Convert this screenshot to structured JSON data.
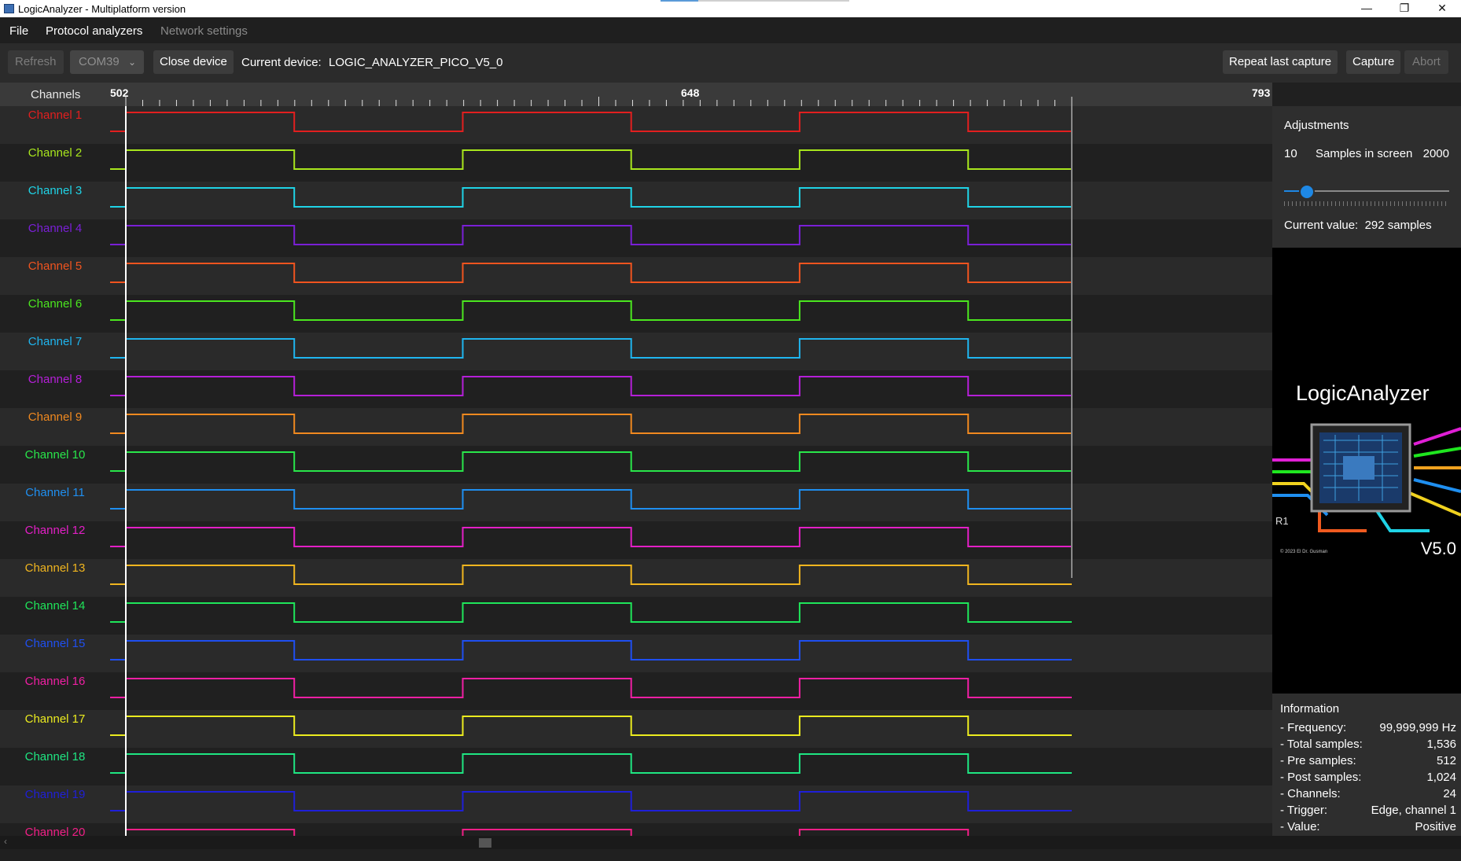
{
  "window": {
    "title": "LogicAnalyzer - Multiplatform version",
    "controls": [
      "—",
      "❐",
      "✕"
    ]
  },
  "menu": {
    "file": "File",
    "protocol_analyzers": "Protocol analyzers",
    "network_settings": "Network settings"
  },
  "toolbar": {
    "refresh": "Refresh",
    "port": "COM39",
    "close_device": "Close device",
    "current_device_label": "Current device:",
    "current_device_value": "LOGIC_ANALYZER_PICO_V5_0",
    "repeat_last_capture": "Repeat last capture",
    "capture": "Capture",
    "abort": "Abort"
  },
  "ruler": {
    "channels_header": "Channels",
    "tick_start": "502",
    "tick_mid": "648",
    "tick_end": "793"
  },
  "channels": [
    {
      "name": "Channel 1",
      "color": "#e21f1f"
    },
    {
      "name": "Channel 2",
      "color": "#a8e61d"
    },
    {
      "name": "Channel 3",
      "color": "#1fd3e6"
    },
    {
      "name": "Channel 4",
      "color": "#7a1fd6"
    },
    {
      "name": "Channel 5",
      "color": "#f0541f"
    },
    {
      "name": "Channel 6",
      "color": "#4be61f"
    },
    {
      "name": "Channel 7",
      "color": "#1fb5ef"
    },
    {
      "name": "Channel 8",
      "color": "#b51fd8"
    },
    {
      "name": "Channel 9",
      "color": "#f0891f"
    },
    {
      "name": "Channel 10",
      "color": "#29e64a"
    },
    {
      "name": "Channel 11",
      "color": "#1f8ff0"
    },
    {
      "name": "Channel 12",
      "color": "#e31fc6"
    },
    {
      "name": "Channel 13",
      "color": "#f0b51f"
    },
    {
      "name": "Channel 14",
      "color": "#1fe65a"
    },
    {
      "name": "Channel 15",
      "color": "#1f4ff0"
    },
    {
      "name": "Channel 16",
      "color": "#f01fa4"
    },
    {
      "name": "Channel 17",
      "color": "#ecec1f"
    },
    {
      "name": "Channel 18",
      "color": "#1fe682"
    },
    {
      "name": "Channel 19",
      "color": "#1f1fd8"
    },
    {
      "name": "Channel 20",
      "color": "#f01f86"
    }
  ],
  "signal": {
    "visible_start_sample": 502,
    "visible_samples": 292,
    "first_rise_sample": 502,
    "period_samples": 104,
    "high_samples": 52,
    "initial_phase": "rise at first sample"
  },
  "adjustments": {
    "title": "Adjustments",
    "min": "10",
    "label": "Samples in screen",
    "max": "2000",
    "slider_fraction": 0.14,
    "current_value_label": "Current value:",
    "current_value": "292 samples"
  },
  "logo": {
    "title": "LogicAnalyzer",
    "version": "V5.0",
    "copyright": "© 2023 El Dr. Gusman",
    "silkscreen": "R1"
  },
  "information": {
    "title": "Information",
    "rows": [
      {
        "key": "- Frequency:",
        "value": "99,999,999 Hz"
      },
      {
        "key": "- Total samples:",
        "value": "1,536"
      },
      {
        "key": "- Pre samples:",
        "value": "512"
      },
      {
        "key": "- Post samples:",
        "value": "1,024"
      },
      {
        "key": "- Channels:",
        "value": "24"
      },
      {
        "key": "- Trigger:",
        "value": "Edge, channel 1"
      },
      {
        "key": "- Value:",
        "value": "Positive"
      }
    ]
  }
}
